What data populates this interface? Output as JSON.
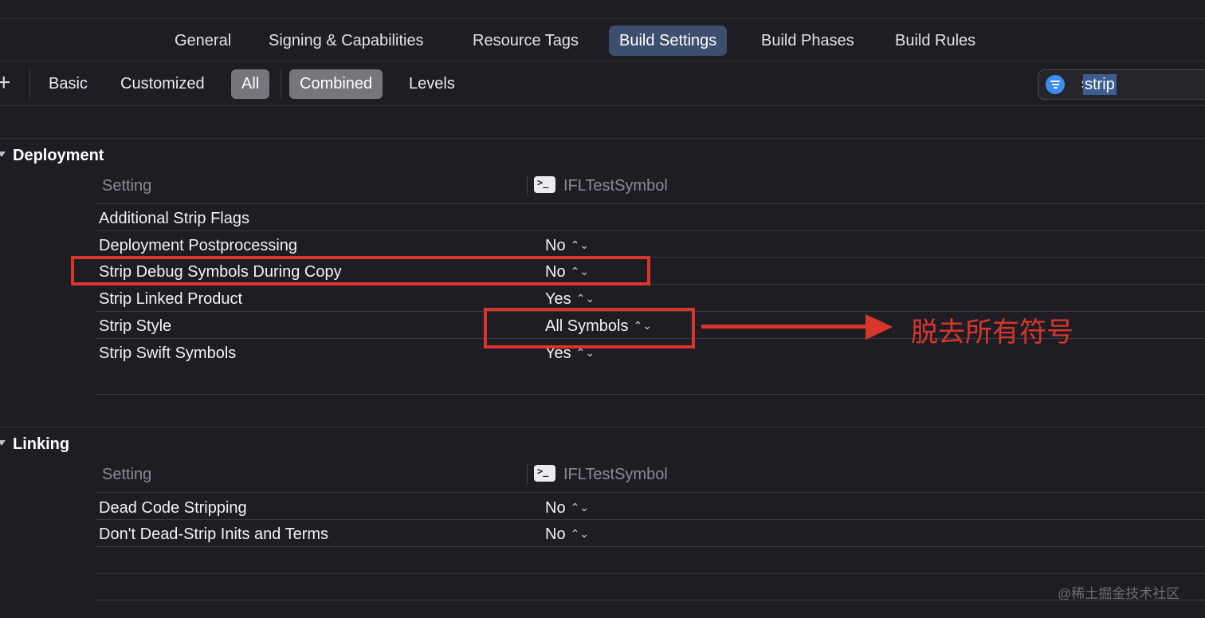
{
  "tabs": [
    {
      "label": "General",
      "active": false
    },
    {
      "label": "Signing & Capabilities",
      "active": false
    },
    {
      "label": "Resource Tags",
      "active": false
    },
    {
      "label": "Build Settings",
      "active": true
    },
    {
      "label": "Build Phases",
      "active": false
    },
    {
      "label": "Build Rules",
      "active": false
    }
  ],
  "filters": {
    "add_symbol": "+",
    "basic": "Basic",
    "customized": "Customized",
    "all": "All",
    "combined": "Combined",
    "levels": "Levels"
  },
  "search": {
    "value": "strip",
    "icon": "filter-icon",
    "accent": "#3a8cf5"
  },
  "sections": [
    {
      "title": "Deployment",
      "column_setting": "Setting",
      "column_target": "IFLTestSymbol",
      "rows": [
        {
          "name": "Additional Strip Flags",
          "value": ""
        },
        {
          "name": "Deployment Postprocessing",
          "value": "No"
        },
        {
          "name": "Strip Debug Symbols During Copy",
          "value": "No"
        },
        {
          "name": "Strip Linked Product",
          "value": "Yes"
        },
        {
          "name": "Strip Style",
          "value": "All Symbols"
        },
        {
          "name": "Strip Swift Symbols",
          "value": "Yes"
        }
      ]
    },
    {
      "title": "Linking",
      "column_setting": "Setting",
      "column_target": "IFLTestSymbol",
      "rows": [
        {
          "name": "Dead Code Stripping",
          "value": "No"
        },
        {
          "name": "Don't Dead-Strip Inits and Terms",
          "value": "No"
        }
      ]
    }
  ],
  "target_icon_glyph": ">_",
  "stepper_glyph": "⌃⌄",
  "annotation": {
    "text": "脱去所有符号",
    "color": "#d9362b"
  },
  "watermark": "@稀土掘金技术社区"
}
